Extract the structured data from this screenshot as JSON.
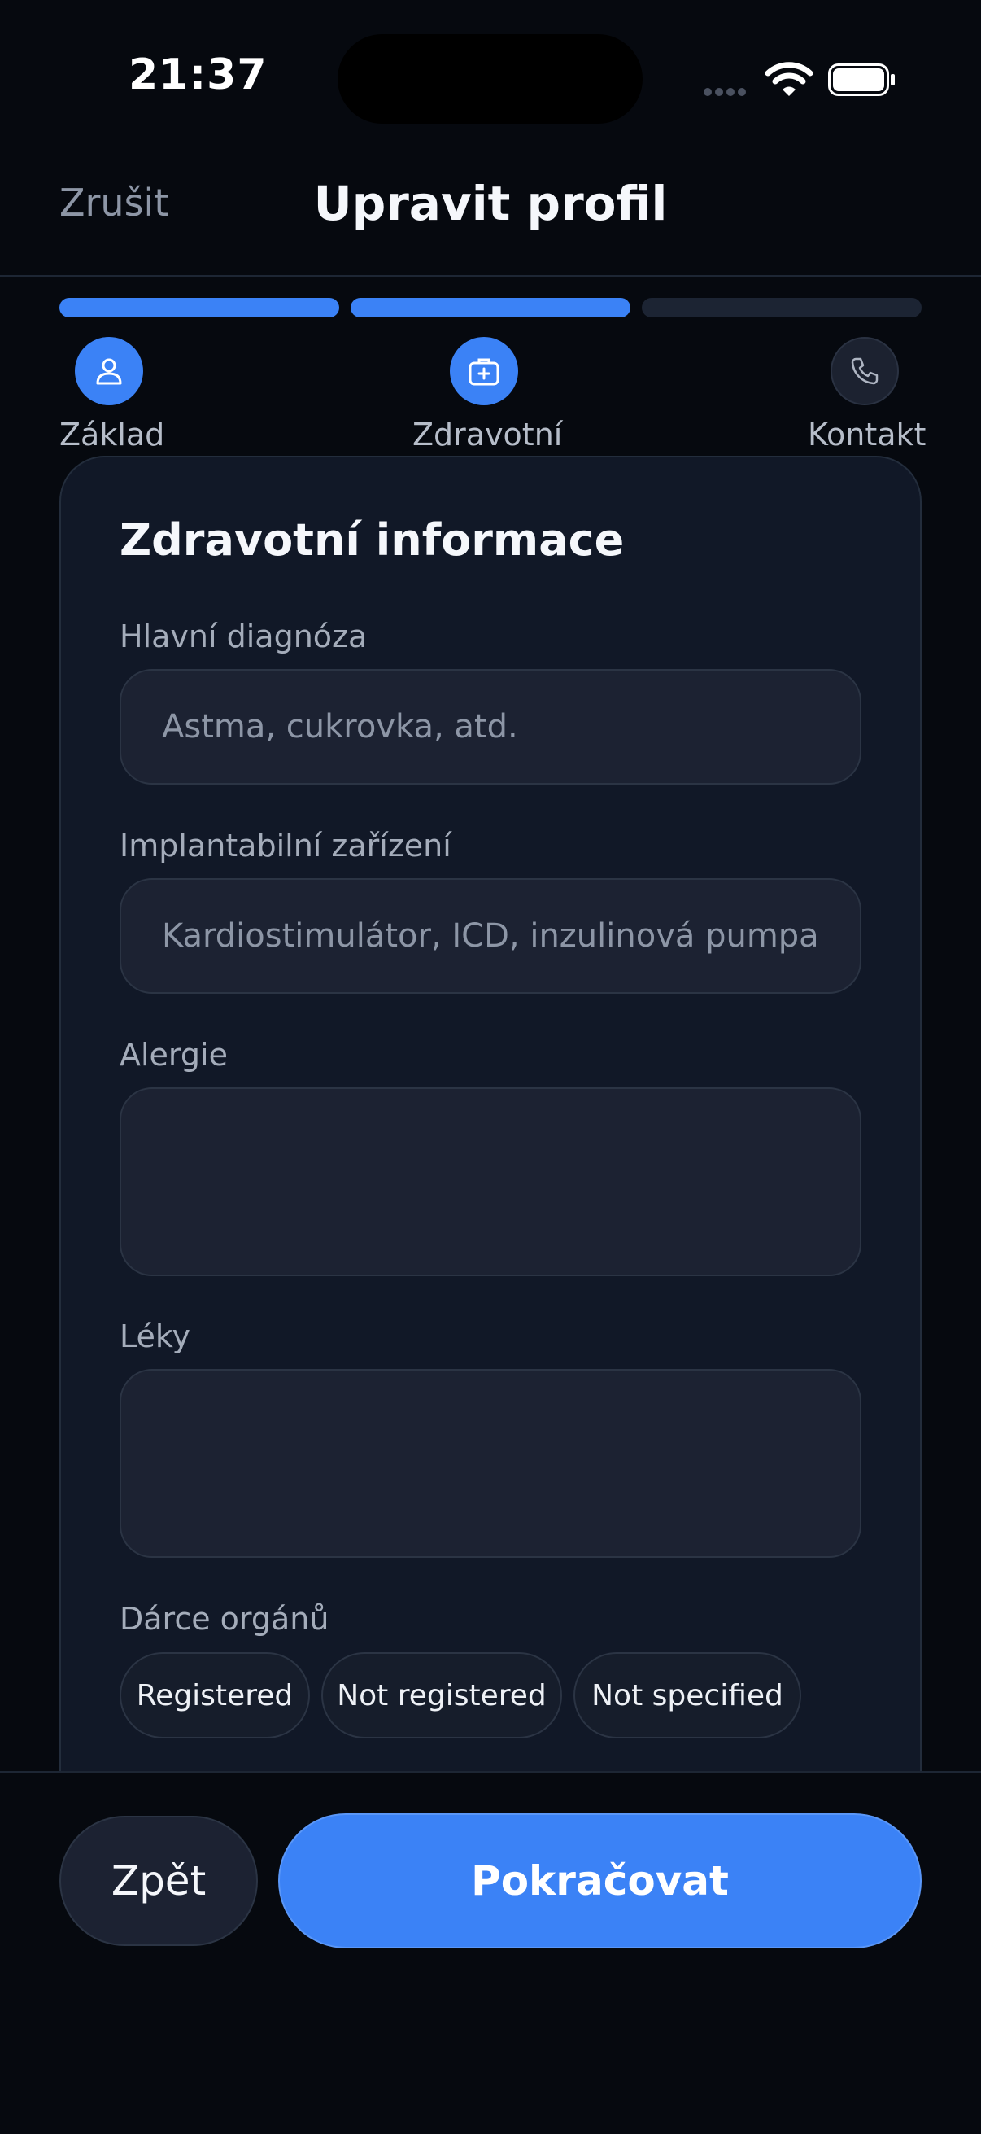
{
  "status_bar": {
    "time": "21:37"
  },
  "header": {
    "cancel_label": "Zrušit",
    "title": "Upravit profil"
  },
  "stepper": {
    "steps": [
      {
        "label": "Základ",
        "icon": "user-icon",
        "state": "done"
      },
      {
        "label": "Zdravotní",
        "icon": "medical-kit-icon",
        "state": "active"
      },
      {
        "label": "Kontakt",
        "icon": "phone-icon",
        "state": "pending"
      }
    ]
  },
  "card": {
    "title": "Zdravotní informace",
    "fields": [
      {
        "label": "Hlavní diagnóza",
        "value": "",
        "placeholder": "Astma, cukrovka, atd."
      },
      {
        "label": "Implantabilní zařízení",
        "value": "",
        "placeholder": "Kardiostimulátor, ICD, inzulinová pumpa"
      },
      {
        "label": "Alergie",
        "value": "",
        "placeholder": ""
      },
      {
        "label": "Léky",
        "value": "",
        "placeholder": ""
      }
    ],
    "organ_donor": {
      "label": "Dárce orgánů",
      "options": [
        "Registered",
        "Not registered",
        "Not specified"
      ]
    }
  },
  "footer": {
    "back_label": "Zpět",
    "continue_label": "Pokračovat"
  },
  "colors": {
    "accent": "#3b82f6",
    "background": "#06090f",
    "card": "#111827",
    "input": "#1c2232"
  }
}
